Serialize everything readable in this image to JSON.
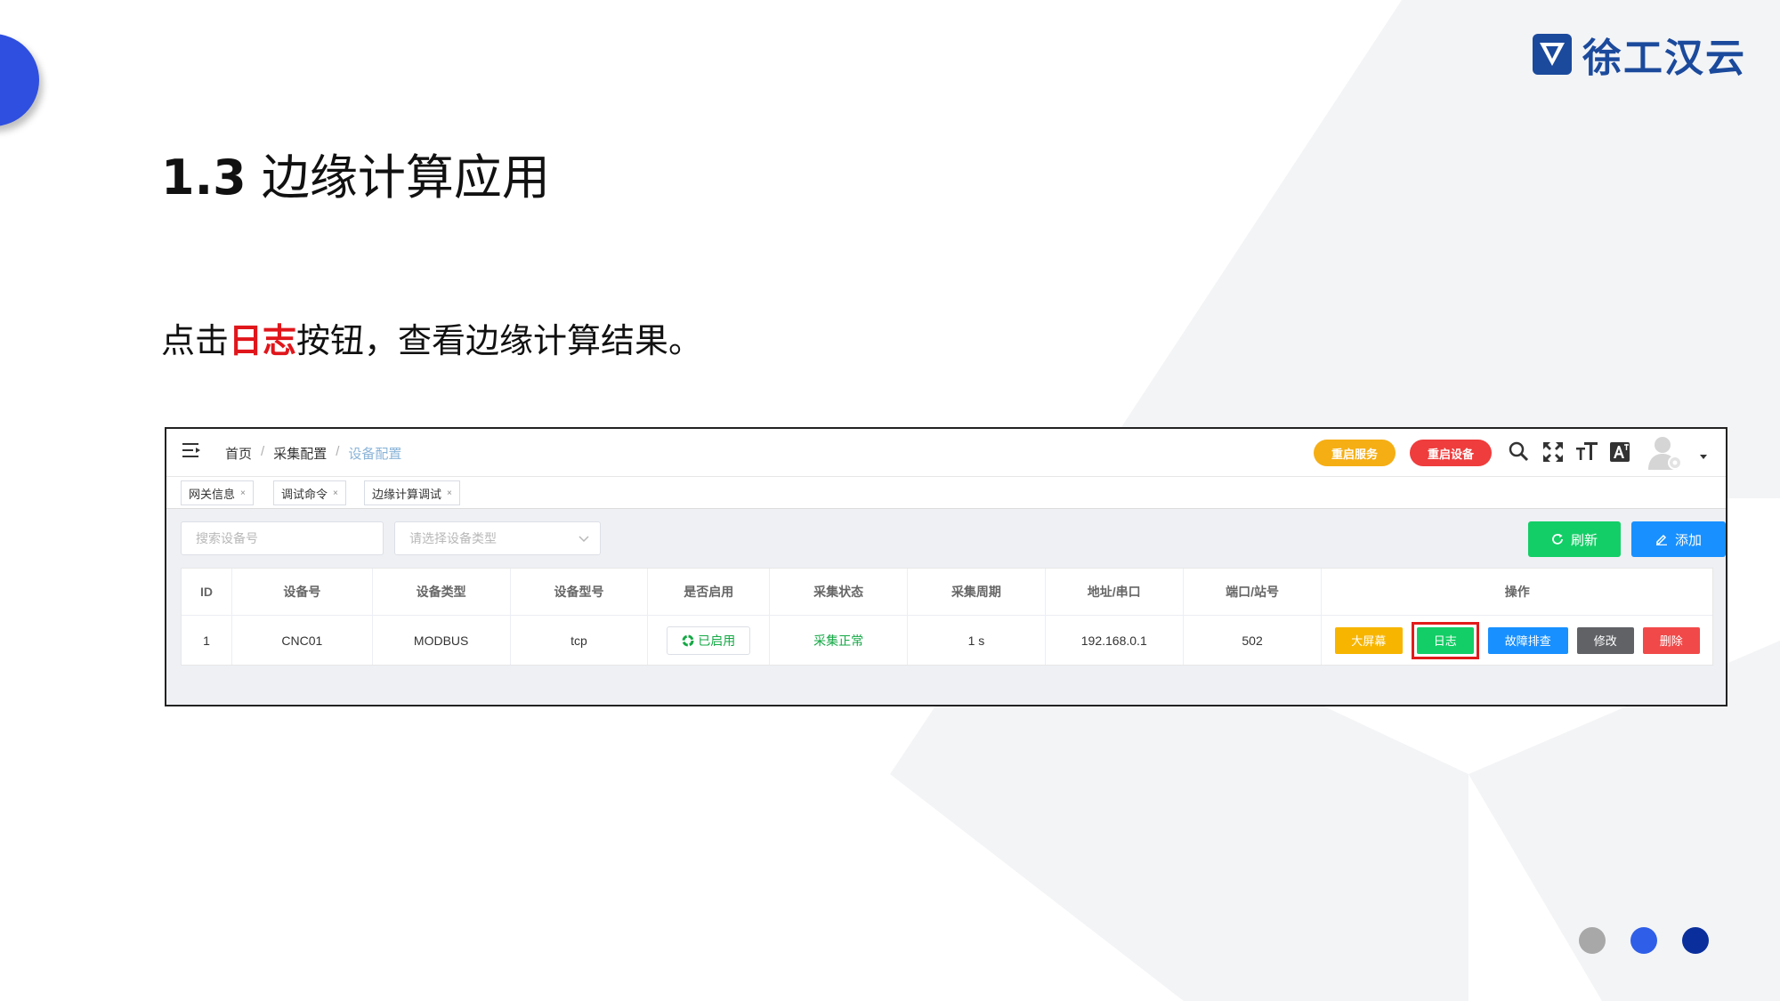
{
  "slide": {
    "title_num": "1.3",
    "title_text": "边缘计算应用",
    "instruction_pre": "点击",
    "instruction_highlight": "日志",
    "instruction_post": "按钮，查看边缘计算结果。"
  },
  "logo": {
    "text": "徐工汉云",
    "color": "#1b4a9c"
  },
  "colors": {
    "accent": "#2f4fe0",
    "highlight": "#e0161b",
    "success": "#13ce66",
    "primary": "#1890ff",
    "warning": "#f7b500",
    "danger": "#f14949"
  },
  "app": {
    "breadcrumb": {
      "home": "首页",
      "sep": "/",
      "config": "采集配置",
      "current": "设备配置"
    },
    "header_buttons": {
      "restart_service": "重启服务",
      "restart_device": "重启设备"
    },
    "header_icons": [
      "search-icon",
      "fullscreen-icon",
      "font-size-icon",
      "translate-icon",
      "user-avatar-icon"
    ],
    "tabs": [
      {
        "label": "网关信息",
        "close": "×"
      },
      {
        "label": "调试命令",
        "close": "×"
      },
      {
        "label": "边缘计算调试",
        "close": "×"
      }
    ],
    "search": {
      "placeholder": "搜索设备号"
    },
    "type_select": {
      "placeholder": "请选择设备类型"
    },
    "toolbar": {
      "refresh": "刷新",
      "add": "添加"
    },
    "table": {
      "headers": [
        "ID",
        "设备号",
        "设备类型",
        "设备型号",
        "是否启用",
        "采集状态",
        "采集周期",
        "地址/串口",
        "端口/站号",
        "操作"
      ],
      "rows": [
        {
          "id": "1",
          "device_no": "CNC01",
          "device_type": "MODBUS",
          "model": "tcp",
          "enabled": "已启用",
          "status": "采集正常",
          "period": "1 s",
          "address": "192.168.0.1",
          "port": "502",
          "actions": {
            "screen": "大屏幕",
            "log": "日志",
            "fault": "故障排查",
            "edit": "修改",
            "delete": "删除"
          }
        }
      ]
    }
  },
  "pager_dots": [
    "#a8a8a8",
    "#2f5fe8",
    "#0a2f9c"
  ]
}
